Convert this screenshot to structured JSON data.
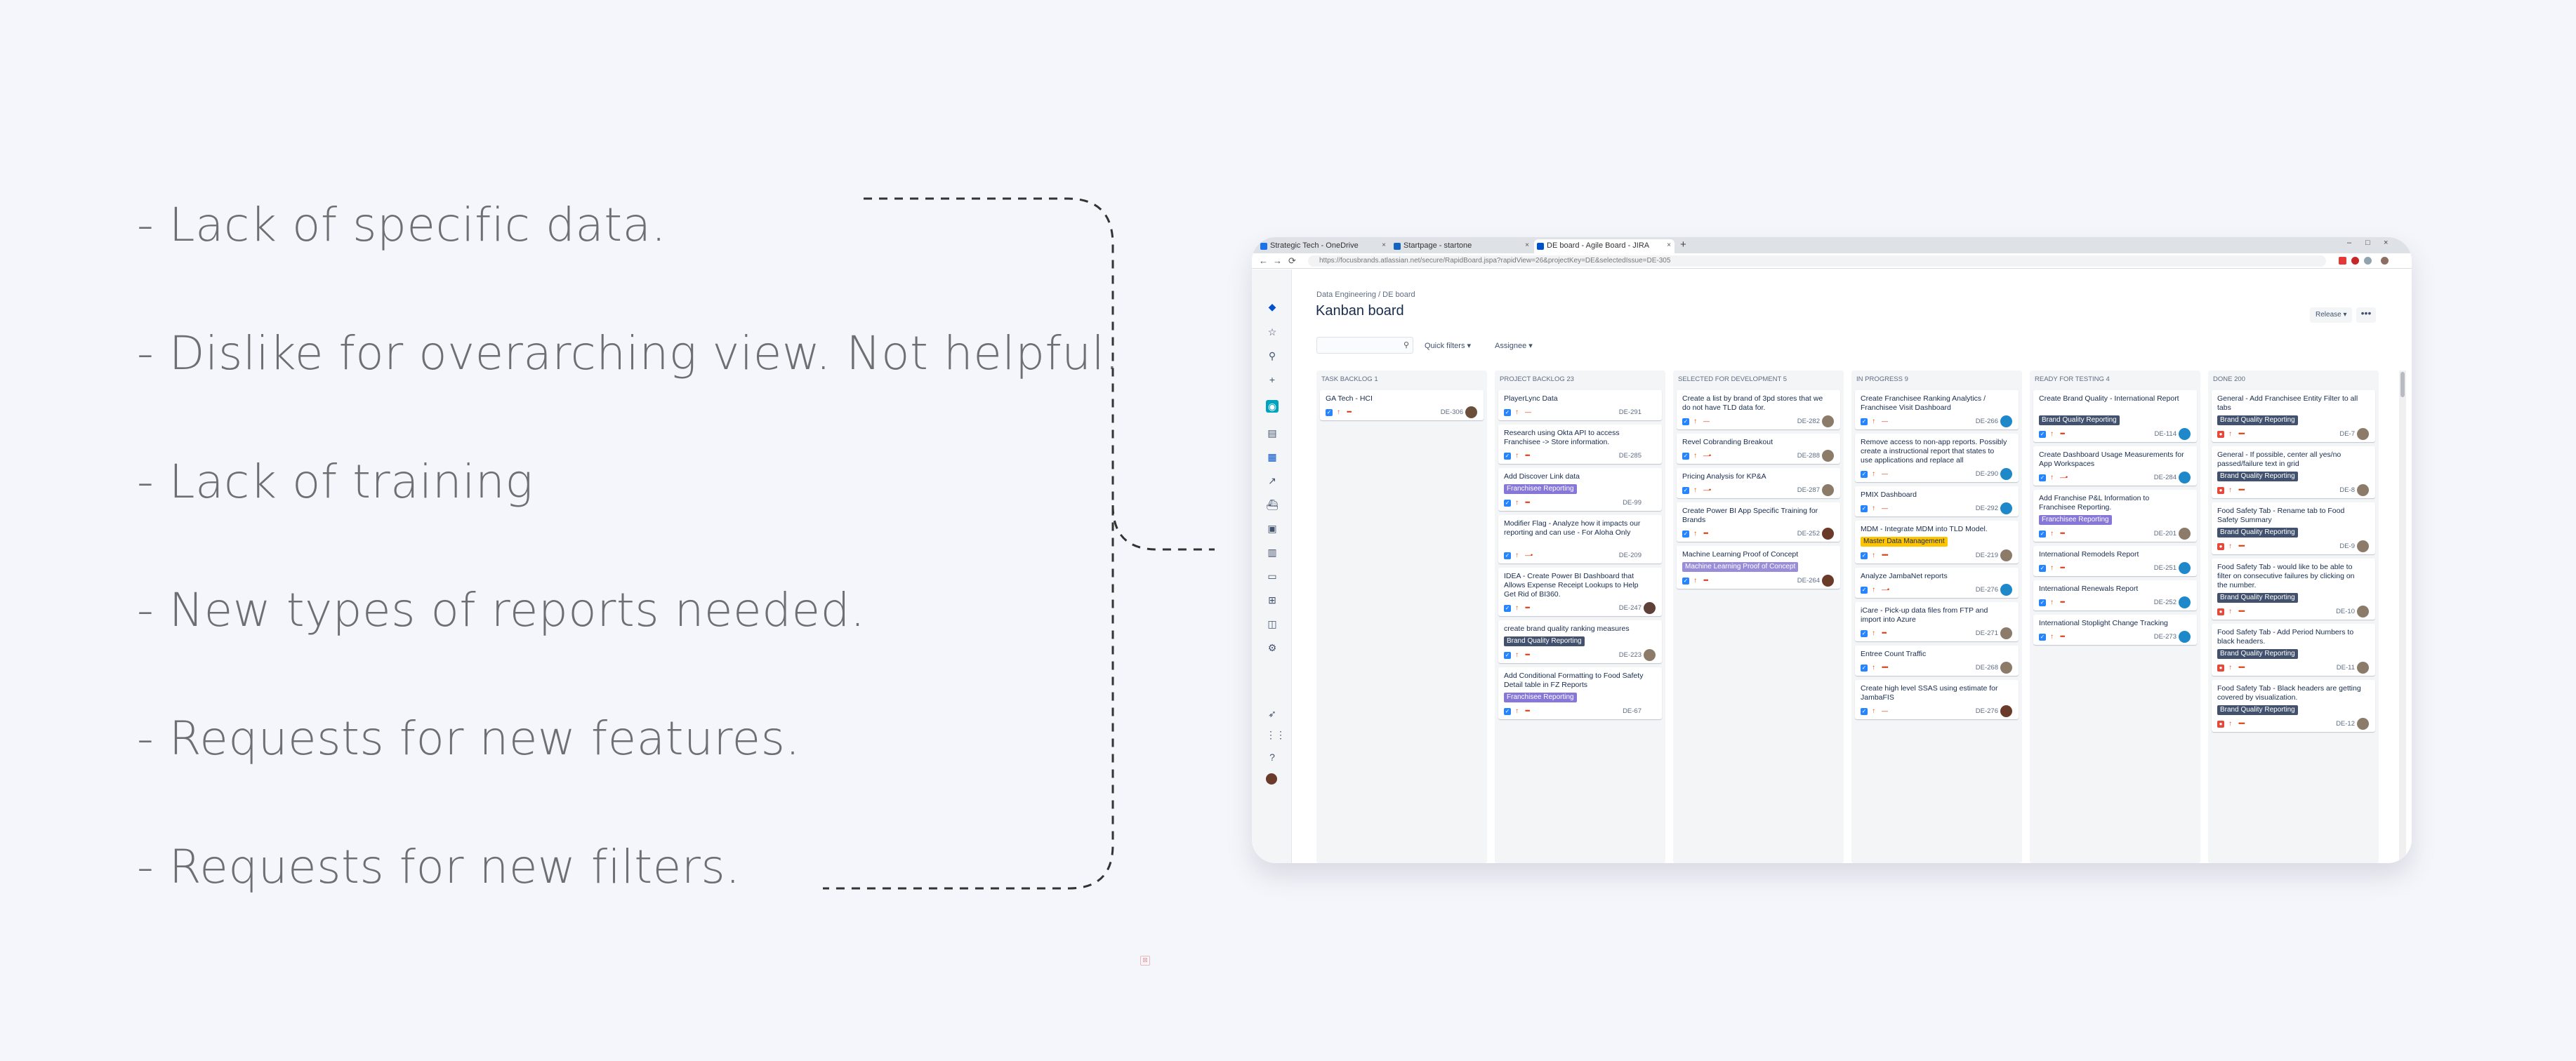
{
  "bullets": [
    "- Lack of specific data.",
    "- Dislike for overarching view. Not helpful.",
    "- Lack of training",
    "- New types of reports needed.",
    "- Requests for new features.",
    "- Requests for new filters."
  ],
  "browser": {
    "tabs": [
      {
        "title": "Strategic Tech - OneDrive",
        "icon_color": "#1a73e8"
      },
      {
        "title": "Startpage - startone",
        "icon_color": "#1565c0"
      },
      {
        "title": "DE board - Agile Board - JIRA",
        "icon_color": "#0052cc",
        "active": true
      }
    ],
    "url": "https://focusbrands.atlassian.net/secure/RapidBoard.jspa?rapidView=26&projectKey=DE&selectedIssue=DE-305",
    "new_tab": "+",
    "close": "×",
    "win_min": "–",
    "win_max": "□",
    "win_close": "×",
    "back": "←",
    "forward": "→",
    "reload": "⟳"
  },
  "jira": {
    "breadcrumb": "Data Engineering  /  DE board",
    "title": "Kanban board",
    "release": "Release ▾",
    "more": "•••",
    "search_glyph": "⚲",
    "quick_filters": "Quick filters ▾",
    "assignee": "Assignee ▾",
    "sidebar_icons": [
      "logo-icon",
      "star-icon",
      "search-icon",
      "plus-icon",
      "project-icon",
      "backlog-icon",
      "board-icon",
      "reports-icon",
      "releases-icon",
      "components-icon",
      "issues-icon",
      "pages-icon",
      "shortcut-icon",
      "addon-icon",
      "settings-icon",
      "rocket-icon",
      "apps-icon",
      "help-icon",
      "profile-icon"
    ],
    "colors": {
      "brand": "#0052cc",
      "story_icon": "#36b37e",
      "task_icon": "#2684ff",
      "bug_icon": "#e5493a",
      "label_blue": "#42526e",
      "label_purple": "#8777d9",
      "label_yellow": "#ffc400",
      "label_lavender": "#998dd9"
    },
    "columns": [
      {
        "title": "TASK BACKLOG 1",
        "cards": [
          {
            "title": "GA Tech - HCI",
            "key": "DE-306",
            "type": "task",
            "dots": "•••",
            "avatar": "#6b4f3b"
          }
        ]
      },
      {
        "title": "PROJECT BACKLOG 23",
        "cards": [
          {
            "title": "PlayerLync Data",
            "key": "DE-291",
            "type": "task",
            "dots": "—"
          },
          {
            "title": "Research using Okta API to access Franchisee -> Store information.",
            "key": "DE-285",
            "type": "task",
            "dots": "•••"
          },
          {
            "title": "Add Discover Link data",
            "key": "DE-99",
            "type": "task",
            "dots": "•••",
            "label": "Franchisee Reporting",
            "label_style": "purple"
          },
          {
            "title": "Modifier Flag - Analyze how it impacts our reporting and can use - For Aloha Only",
            "key": "DE-209",
            "type": "task",
            "dots": "—•"
          },
          {
            "title": "IDEA - Create Power BI Dashboard that Allows Expense Receipt Lookups to Help Get Rid of BI360.",
            "key": "DE-247",
            "type": "task",
            "dots": "•••",
            "avatar": "#5d4037"
          },
          {
            "title": "create brand quality ranking measures",
            "key": "DE-223",
            "type": "task",
            "dots": "•••",
            "label": "Brand Quality Reporting",
            "label_style": "blue",
            "avatar": "#8d7b6a"
          },
          {
            "title": "Add Conditional Formatting to Food Safety Detail table in FZ Reports",
            "key": "DE-67",
            "type": "task",
            "dots": "•••",
            "label": "Franchisee Reporting",
            "label_style": "purple"
          }
        ]
      },
      {
        "title": "SELECTED FOR DEVELOPMENT 5",
        "cards": [
          {
            "title": "Create a list by brand of 3pd stores that we do not have TLD data for.",
            "key": "DE-282",
            "type": "task",
            "dots": "—",
            "avatar": "#8d7b6a"
          },
          {
            "title": "Revel Cobranding Breakout",
            "key": "DE-288",
            "type": "task",
            "dots": "—•",
            "avatar": "#8d7b6a"
          },
          {
            "title": "Pricing Analysis for KP&A",
            "key": "DE-287",
            "type": "task",
            "dots": "—•",
            "avatar": "#8d7b6a"
          },
          {
            "title": "Create Power BI App Specific Training for Brands",
            "key": "DE-252",
            "type": "task",
            "dots": "•••",
            "avatar": "#6b3b2a"
          },
          {
            "title": "Machine Learning Proof of Concept",
            "key": "DE-264",
            "type": "task",
            "dots": "•••",
            "label": "Machine Learning Proof of Concept",
            "label_style": "lavender",
            "avatar": "#6b3b2a"
          }
        ]
      },
      {
        "title": "IN PROGRESS 9",
        "cards": [
          {
            "title": "Create Franchisee Ranking Analytics / Franchisee Visit Dashboard",
            "key": "DE-266",
            "type": "task",
            "dots": "—",
            "avatar": "#1e88c8"
          },
          {
            "title": "Remove access to non-app reports. Possibly create a instructional report that states to use applications and replace all",
            "key": "DE-290",
            "type": "task",
            "dots": "—",
            "avatar": "#1e88c8"
          },
          {
            "title": "PMIX Dashboard",
            "key": "DE-292",
            "type": "task",
            "dots": "—",
            "avatar": "#1e88c8"
          },
          {
            "title": "MDM - Integrate MDM into TLD Model.",
            "key": "DE-219",
            "type": "task",
            "dots": "••••",
            "label": "Master Data Management",
            "label_style": "yellow",
            "avatar": "#8d7b6a"
          },
          {
            "title": "Analyze JambaNet reports",
            "key": "DE-276",
            "type": "task",
            "dots": "—•",
            "avatar": "#1e88c8"
          },
          {
            "title": "iCare - Pick-up data files from FTP and import into Azure",
            "key": "DE-271",
            "type": "task",
            "dots": "•••",
            "avatar": "#8d7b6a"
          },
          {
            "title": "Entree Count Traffic",
            "key": "DE-268",
            "type": "task",
            "dots": "••••",
            "avatar": "#8d7b6a"
          },
          {
            "title": "Create high level SSAS using estimate for JambaFIS",
            "key": "DE-276",
            "type": "task",
            "dots": "—",
            "avatar": "#6b3b2a"
          }
        ]
      },
      {
        "title": "READY FOR TESTING 4",
        "cards": [
          {
            "title": "Create Brand Quality - International Report",
            "key": "DE-114",
            "type": "task",
            "dots": "•••",
            "label": "Brand Quality Reporting",
            "label_style": "blue",
            "avatar": "#1e88c8"
          },
          {
            "title": "Create Dashboard Usage Measurements for App Workspaces",
            "key": "DE-284",
            "type": "task",
            "dots": "—•",
            "avatar": "#1e88c8"
          },
          {
            "title": "Add Franchise P&L Information to Franchisee Reporting.",
            "key": "DE-201",
            "type": "task",
            "dots": "•••",
            "label": "Franchisee Reporting",
            "label_style": "purple",
            "avatar": "#8d7b6a"
          },
          {
            "title": "International Remodels Report",
            "key": "DE-251",
            "type": "task",
            "dots": "•••",
            "avatar": "#1e88c8"
          },
          {
            "title": "International Renewals Report",
            "key": "DE-252",
            "type": "task",
            "dots": "•••",
            "avatar": "#1e88c8"
          },
          {
            "title": "International Stoplight Change Tracking",
            "key": "DE-273",
            "type": "task",
            "dots": "•••",
            "avatar": "#1e88c8"
          }
        ]
      },
      {
        "title": "DONE 200",
        "cards": [
          {
            "title": "General - Add Franchisee Entity Filter to all tabs",
            "key": "DE-7",
            "type": "bug",
            "dots": "••••",
            "label": "Brand Quality Reporting",
            "label_style": "blue",
            "avatar": "#8d7b6a"
          },
          {
            "title": "General - If possible, center all yes/no passed/failure text in grid",
            "key": "DE-8",
            "type": "bug",
            "dots": "••••",
            "label": "Brand Quality Reporting",
            "label_style": "blue",
            "avatar": "#8d7b6a"
          },
          {
            "title": "Food Safety Tab - Rename tab to Food Safety Summary",
            "key": "DE-9",
            "type": "bug",
            "dots": "••••",
            "label": "Brand Quality Reporting",
            "label_style": "blue",
            "avatar": "#8d7b6a"
          },
          {
            "title": "Food Safety Tab - would like to be able to filter on consecutive failures by clicking on the number.",
            "key": "DE-10",
            "type": "bug",
            "dots": "••••",
            "label": "Brand Quality Reporting",
            "label_style": "blue",
            "avatar": "#8d7b6a"
          },
          {
            "title": "Food Safety Tab - Add Period Numbers to black headers.",
            "key": "DE-11",
            "type": "bug",
            "dots": "••••",
            "label": "Brand Quality Reporting",
            "label_style": "blue",
            "avatar": "#8d7b6a"
          },
          {
            "title": "Food Safety Tab - Black headers are getting covered by visualization.",
            "key": "DE-12",
            "type": "bug",
            "dots": "••••",
            "label": "Brand Quality Reporting",
            "label_style": "blue",
            "avatar": "#8d7b6a"
          }
        ]
      }
    ]
  },
  "corner_mark": "⊠"
}
